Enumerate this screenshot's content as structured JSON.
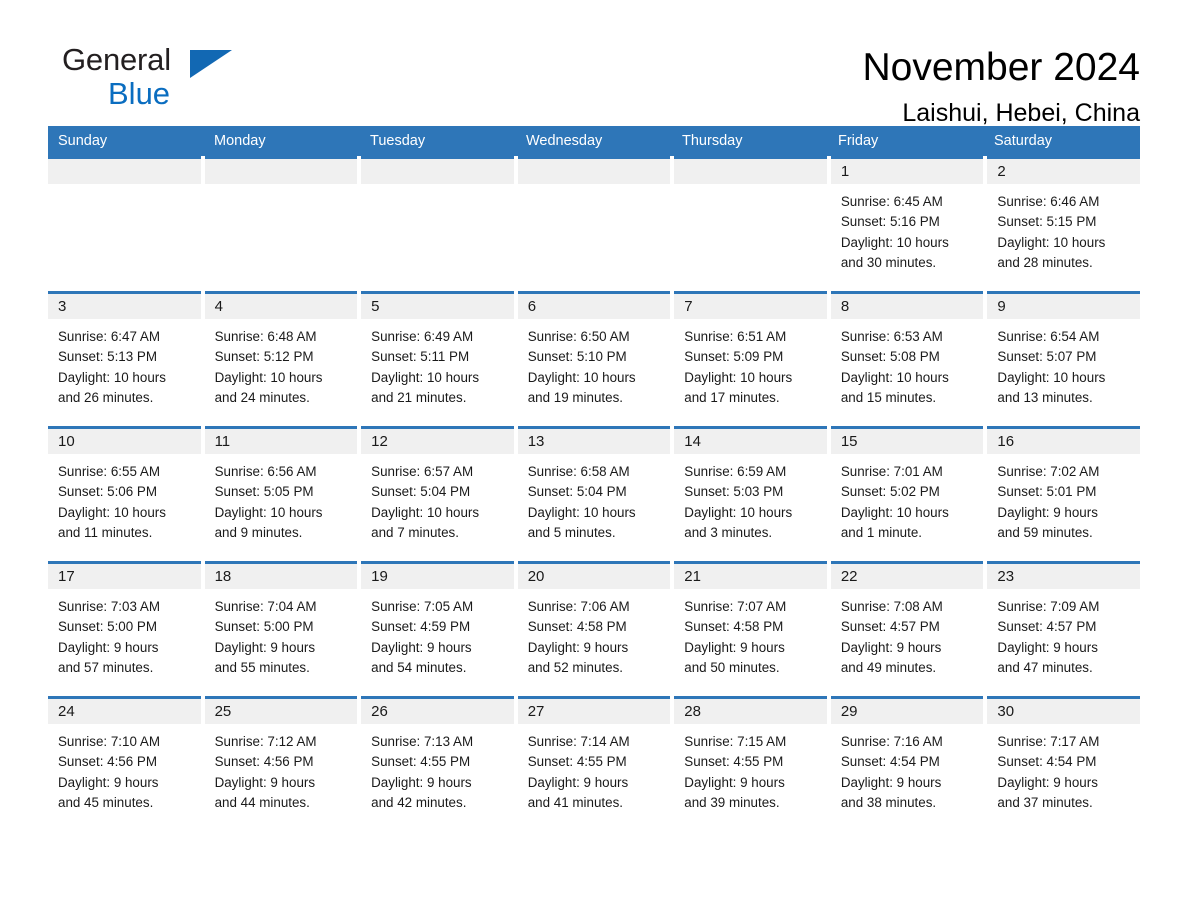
{
  "brand": {
    "name_part1": "General",
    "name_part2": "Blue",
    "triangle_icon": "triangle-icon",
    "colors": {
      "text": "#231f20",
      "blue": "#0a6dc0",
      "triangle": "#1268b3"
    }
  },
  "header": {
    "title": "November 2024",
    "subtitle": "Laishui, Hebei, China"
  },
  "theme": {
    "header_blue": "#2e76b8",
    "day_band_gray": "#f0f0f0",
    "text": "#1a1a1a"
  },
  "weekdays": [
    "Sunday",
    "Monday",
    "Tuesday",
    "Wednesday",
    "Thursday",
    "Friday",
    "Saturday"
  ],
  "weeks": [
    [
      {
        "day": "",
        "sunrise": "",
        "sunset": "",
        "daylight_line1": "",
        "daylight_line2": "",
        "empty": true
      },
      {
        "day": "",
        "sunrise": "",
        "sunset": "",
        "daylight_line1": "",
        "daylight_line2": "",
        "empty": true
      },
      {
        "day": "",
        "sunrise": "",
        "sunset": "",
        "daylight_line1": "",
        "daylight_line2": "",
        "empty": true
      },
      {
        "day": "",
        "sunrise": "",
        "sunset": "",
        "daylight_line1": "",
        "daylight_line2": "",
        "empty": true
      },
      {
        "day": "",
        "sunrise": "",
        "sunset": "",
        "daylight_line1": "",
        "daylight_line2": "",
        "empty": true
      },
      {
        "day": "1",
        "sunrise": "Sunrise: 6:45 AM",
        "sunset": "Sunset: 5:16 PM",
        "daylight_line1": "Daylight: 10 hours",
        "daylight_line2": "and 30 minutes.",
        "empty": false
      },
      {
        "day": "2",
        "sunrise": "Sunrise: 6:46 AM",
        "sunset": "Sunset: 5:15 PM",
        "daylight_line1": "Daylight: 10 hours",
        "daylight_line2": "and 28 minutes.",
        "empty": false
      }
    ],
    [
      {
        "day": "3",
        "sunrise": "Sunrise: 6:47 AM",
        "sunset": "Sunset: 5:13 PM",
        "daylight_line1": "Daylight: 10 hours",
        "daylight_line2": "and 26 minutes.",
        "empty": false
      },
      {
        "day": "4",
        "sunrise": "Sunrise: 6:48 AM",
        "sunset": "Sunset: 5:12 PM",
        "daylight_line1": "Daylight: 10 hours",
        "daylight_line2": "and 24 minutes.",
        "empty": false
      },
      {
        "day": "5",
        "sunrise": "Sunrise: 6:49 AM",
        "sunset": "Sunset: 5:11 PM",
        "daylight_line1": "Daylight: 10 hours",
        "daylight_line2": "and 21 minutes.",
        "empty": false
      },
      {
        "day": "6",
        "sunrise": "Sunrise: 6:50 AM",
        "sunset": "Sunset: 5:10 PM",
        "daylight_line1": "Daylight: 10 hours",
        "daylight_line2": "and 19 minutes.",
        "empty": false
      },
      {
        "day": "7",
        "sunrise": "Sunrise: 6:51 AM",
        "sunset": "Sunset: 5:09 PM",
        "daylight_line1": "Daylight: 10 hours",
        "daylight_line2": "and 17 minutes.",
        "empty": false
      },
      {
        "day": "8",
        "sunrise": "Sunrise: 6:53 AM",
        "sunset": "Sunset: 5:08 PM",
        "daylight_line1": "Daylight: 10 hours",
        "daylight_line2": "and 15 minutes.",
        "empty": false
      },
      {
        "day": "9",
        "sunrise": "Sunrise: 6:54 AM",
        "sunset": "Sunset: 5:07 PM",
        "daylight_line1": "Daylight: 10 hours",
        "daylight_line2": "and 13 minutes.",
        "empty": false
      }
    ],
    [
      {
        "day": "10",
        "sunrise": "Sunrise: 6:55 AM",
        "sunset": "Sunset: 5:06 PM",
        "daylight_line1": "Daylight: 10 hours",
        "daylight_line2": "and 11 minutes.",
        "empty": false
      },
      {
        "day": "11",
        "sunrise": "Sunrise: 6:56 AM",
        "sunset": "Sunset: 5:05 PM",
        "daylight_line1": "Daylight: 10 hours",
        "daylight_line2": "and 9 minutes.",
        "empty": false
      },
      {
        "day": "12",
        "sunrise": "Sunrise: 6:57 AM",
        "sunset": "Sunset: 5:04 PM",
        "daylight_line1": "Daylight: 10 hours",
        "daylight_line2": "and 7 minutes.",
        "empty": false
      },
      {
        "day": "13",
        "sunrise": "Sunrise: 6:58 AM",
        "sunset": "Sunset: 5:04 PM",
        "daylight_line1": "Daylight: 10 hours",
        "daylight_line2": "and 5 minutes.",
        "empty": false
      },
      {
        "day": "14",
        "sunrise": "Sunrise: 6:59 AM",
        "sunset": "Sunset: 5:03 PM",
        "daylight_line1": "Daylight: 10 hours",
        "daylight_line2": "and 3 minutes.",
        "empty": false
      },
      {
        "day": "15",
        "sunrise": "Sunrise: 7:01 AM",
        "sunset": "Sunset: 5:02 PM",
        "daylight_line1": "Daylight: 10 hours",
        "daylight_line2": "and 1 minute.",
        "empty": false
      },
      {
        "day": "16",
        "sunrise": "Sunrise: 7:02 AM",
        "sunset": "Sunset: 5:01 PM",
        "daylight_line1": "Daylight: 9 hours",
        "daylight_line2": "and 59 minutes.",
        "empty": false
      }
    ],
    [
      {
        "day": "17",
        "sunrise": "Sunrise: 7:03 AM",
        "sunset": "Sunset: 5:00 PM",
        "daylight_line1": "Daylight: 9 hours",
        "daylight_line2": "and 57 minutes.",
        "empty": false
      },
      {
        "day": "18",
        "sunrise": "Sunrise: 7:04 AM",
        "sunset": "Sunset: 5:00 PM",
        "daylight_line1": "Daylight: 9 hours",
        "daylight_line2": "and 55 minutes.",
        "empty": false
      },
      {
        "day": "19",
        "sunrise": "Sunrise: 7:05 AM",
        "sunset": "Sunset: 4:59 PM",
        "daylight_line1": "Daylight: 9 hours",
        "daylight_line2": "and 54 minutes.",
        "empty": false
      },
      {
        "day": "20",
        "sunrise": "Sunrise: 7:06 AM",
        "sunset": "Sunset: 4:58 PM",
        "daylight_line1": "Daylight: 9 hours",
        "daylight_line2": "and 52 minutes.",
        "empty": false
      },
      {
        "day": "21",
        "sunrise": "Sunrise: 7:07 AM",
        "sunset": "Sunset: 4:58 PM",
        "daylight_line1": "Daylight: 9 hours",
        "daylight_line2": "and 50 minutes.",
        "empty": false
      },
      {
        "day": "22",
        "sunrise": "Sunrise: 7:08 AM",
        "sunset": "Sunset: 4:57 PM",
        "daylight_line1": "Daylight: 9 hours",
        "daylight_line2": "and 49 minutes.",
        "empty": false
      },
      {
        "day": "23",
        "sunrise": "Sunrise: 7:09 AM",
        "sunset": "Sunset: 4:57 PM",
        "daylight_line1": "Daylight: 9 hours",
        "daylight_line2": "and 47 minutes.",
        "empty": false
      }
    ],
    [
      {
        "day": "24",
        "sunrise": "Sunrise: 7:10 AM",
        "sunset": "Sunset: 4:56 PM",
        "daylight_line1": "Daylight: 9 hours",
        "daylight_line2": "and 45 minutes.",
        "empty": false
      },
      {
        "day": "25",
        "sunrise": "Sunrise: 7:12 AM",
        "sunset": "Sunset: 4:56 PM",
        "daylight_line1": "Daylight: 9 hours",
        "daylight_line2": "and 44 minutes.",
        "empty": false
      },
      {
        "day": "26",
        "sunrise": "Sunrise: 7:13 AM",
        "sunset": "Sunset: 4:55 PM",
        "daylight_line1": "Daylight: 9 hours",
        "daylight_line2": "and 42 minutes.",
        "empty": false
      },
      {
        "day": "27",
        "sunrise": "Sunrise: 7:14 AM",
        "sunset": "Sunset: 4:55 PM",
        "daylight_line1": "Daylight: 9 hours",
        "daylight_line2": "and 41 minutes.",
        "empty": false
      },
      {
        "day": "28",
        "sunrise": "Sunrise: 7:15 AM",
        "sunset": "Sunset: 4:55 PM",
        "daylight_line1": "Daylight: 9 hours",
        "daylight_line2": "and 39 minutes.",
        "empty": false
      },
      {
        "day": "29",
        "sunrise": "Sunrise: 7:16 AM",
        "sunset": "Sunset: 4:54 PM",
        "daylight_line1": "Daylight: 9 hours",
        "daylight_line2": "and 38 minutes.",
        "empty": false
      },
      {
        "day": "30",
        "sunrise": "Sunrise: 7:17 AM",
        "sunset": "Sunset: 4:54 PM",
        "daylight_line1": "Daylight: 9 hours",
        "daylight_line2": "and 37 minutes.",
        "empty": false
      }
    ]
  ]
}
